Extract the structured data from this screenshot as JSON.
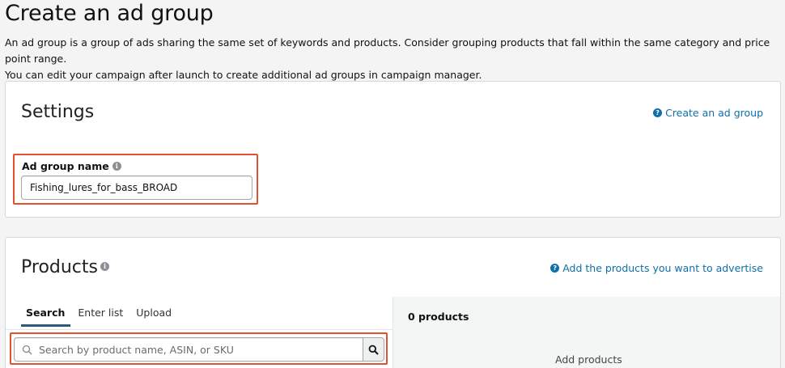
{
  "page": {
    "title": "Create an ad group",
    "intro_line1": "An ad group is a group of ads sharing the same set of keywords and products. Consider grouping products that fall within the same category and price point range.",
    "intro_line2": "You can edit your campaign after launch to create additional ad groups in campaign manager."
  },
  "settings": {
    "title": "Settings",
    "help_link": "Create an ad group",
    "ad_group_name_label": "Ad group name",
    "ad_group_name_value": "Fishing_lures_for_bass_BROAD"
  },
  "products": {
    "title": "Products",
    "help_link": "Add the products you want to advertise",
    "tabs": [
      "Search",
      "Enter list",
      "Upload"
    ],
    "active_tab": "Search",
    "search_placeholder": "Search by product name, ASIN, or SKU",
    "count_label": "0 products",
    "empty_label": "Add products"
  },
  "colors": {
    "highlight": "#e0512f",
    "link": "#0f6fa8",
    "active_tab_underline": "#2c5a7e"
  },
  "icons": {
    "help": "help-circle-icon",
    "info": "info-circle-icon",
    "search": "magnifier-icon"
  }
}
